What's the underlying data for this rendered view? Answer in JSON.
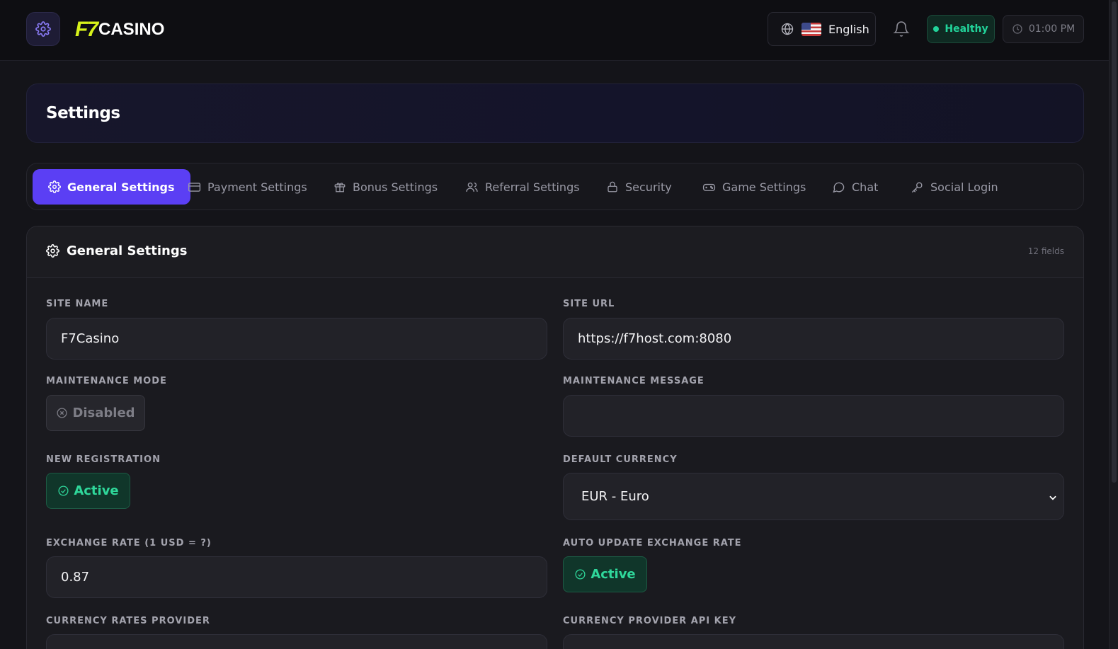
{
  "header": {
    "logo_mark": "F7",
    "logo_text": "CASINO",
    "language": "English",
    "status": "Healthy",
    "time": "01:00 PM"
  },
  "page": {
    "title": "Settings"
  },
  "tabs": [
    {
      "label": "General Settings",
      "icon": "gear-icon",
      "active": true
    },
    {
      "label": "Payment Settings",
      "icon": "credit-card-icon",
      "active": false
    },
    {
      "label": "Bonus Settings",
      "icon": "gift-icon",
      "active": false
    },
    {
      "label": "Referral Settings",
      "icon": "users-icon",
      "active": false
    },
    {
      "label": "Security",
      "icon": "lock-icon",
      "active": false
    },
    {
      "label": "Game Settings",
      "icon": "gamepad-icon",
      "active": false
    },
    {
      "label": "Chat",
      "icon": "chat-bubble-icon",
      "active": false
    },
    {
      "label": "Social Login",
      "icon": "key-icon",
      "active": false
    }
  ],
  "panel": {
    "title": "General Settings",
    "field_count": "12 fields",
    "fields": {
      "site_name": {
        "label": "SITE NAME",
        "value": "F7Casino"
      },
      "site_url": {
        "label": "SITE URL",
        "value": "https://f7host.com:8080"
      },
      "maintenance_mode": {
        "label": "MAINTENANCE MODE",
        "value": "Disabled"
      },
      "maintenance_message": {
        "label": "MAINTENANCE MESSAGE",
        "value": ""
      },
      "new_registration": {
        "label": "NEW REGISTRATION",
        "value": "Active"
      },
      "default_currency": {
        "label": "DEFAULT CURRENCY",
        "value": "EUR - Euro"
      },
      "exchange_rate": {
        "label": "EXCHANGE RATE (1 USD = ?)",
        "value": "0.87"
      },
      "auto_update_exchange_rate": {
        "label": "AUTO UPDATE EXCHANGE RATE",
        "value": "Active"
      },
      "currency_rates_provider": {
        "label": "CURRENCY RATES PROVIDER"
      },
      "currency_provider_api_key": {
        "label": "CURRENCY PROVIDER API KEY"
      }
    }
  },
  "colors": {
    "accent": "#5b3ff4",
    "logo": "#d7f21b",
    "success": "#2fd89b",
    "background": "#141419"
  }
}
